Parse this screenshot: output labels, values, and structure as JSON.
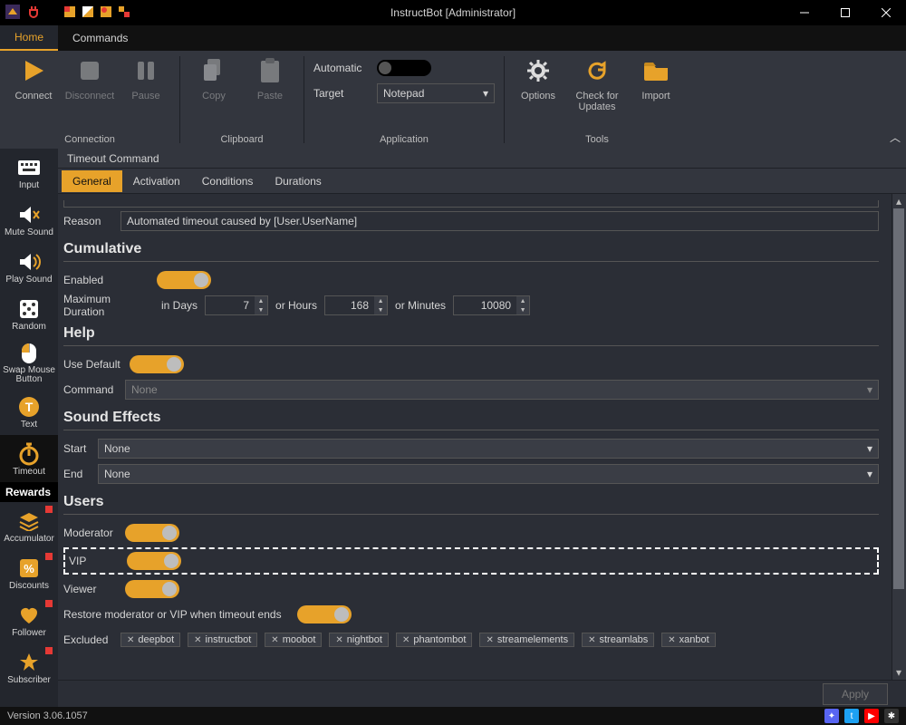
{
  "window": {
    "title": "InstructBot [Administrator]"
  },
  "tabs": {
    "home": "Home",
    "commands": "Commands"
  },
  "ribbon": {
    "connection": {
      "label": "Connection",
      "connect": "Connect",
      "disconnect": "Disconnect",
      "pause": "Pause"
    },
    "clipboard": {
      "label": "Clipboard",
      "copy": "Copy",
      "paste": "Paste"
    },
    "application": {
      "label": "Application",
      "automatic": "Automatic",
      "target": "Target",
      "target_value": "Notepad"
    },
    "tools": {
      "label": "Tools",
      "options": "Options",
      "check": "Check for Updates",
      "import": "Import"
    }
  },
  "sidebar": {
    "items": [
      {
        "key": "input",
        "label": "Input"
      },
      {
        "key": "mute",
        "label": "Mute Sound"
      },
      {
        "key": "play",
        "label": "Play Sound"
      },
      {
        "key": "random",
        "label": "Random"
      },
      {
        "key": "swap",
        "label": "Swap Mouse Button"
      },
      {
        "key": "text",
        "label": "Text"
      },
      {
        "key": "timeout",
        "label": "Timeout"
      }
    ],
    "rewards_header": "Rewards",
    "rewards": [
      {
        "key": "accumulator",
        "label": "Accumulator",
        "badge": true
      },
      {
        "key": "discounts",
        "label": "Discounts",
        "badge": true
      },
      {
        "key": "follower",
        "label": "Follower",
        "badge": true
      },
      {
        "key": "subscriber",
        "label": "Subscriber",
        "badge": true
      }
    ]
  },
  "crumb": "Timeout Command",
  "subtabs": [
    "General",
    "Activation",
    "Conditions",
    "Durations"
  ],
  "form": {
    "reason_label": "Reason",
    "reason_value": "Automated timeout caused by [User.UserName]",
    "cumulative": {
      "title": "Cumulative",
      "enabled": "Enabled",
      "max_label": "Maximum Duration",
      "in_days": "in Days",
      "days": "7",
      "or_hours": "or Hours",
      "hours": "168",
      "or_minutes": "or Minutes",
      "minutes": "10080"
    },
    "help": {
      "title": "Help",
      "use_default": "Use Default",
      "command_label": "Command",
      "command_value": "None"
    },
    "sound": {
      "title": "Sound Effects",
      "start": "Start",
      "start_value": "None",
      "end": "End",
      "end_value": "None"
    },
    "users": {
      "title": "Users",
      "moderator": "Moderator",
      "vip": "VIP",
      "viewer": "Viewer",
      "restore": "Restore moderator or VIP when timeout ends",
      "excluded": "Excluded",
      "tags": [
        "deepbot",
        "instructbot",
        "moobot",
        "nightbot",
        "phantombot",
        "streamelements",
        "streamlabs",
        "xanbot"
      ]
    }
  },
  "apply": "Apply",
  "status": {
    "version": "Version 3.06.1057"
  }
}
